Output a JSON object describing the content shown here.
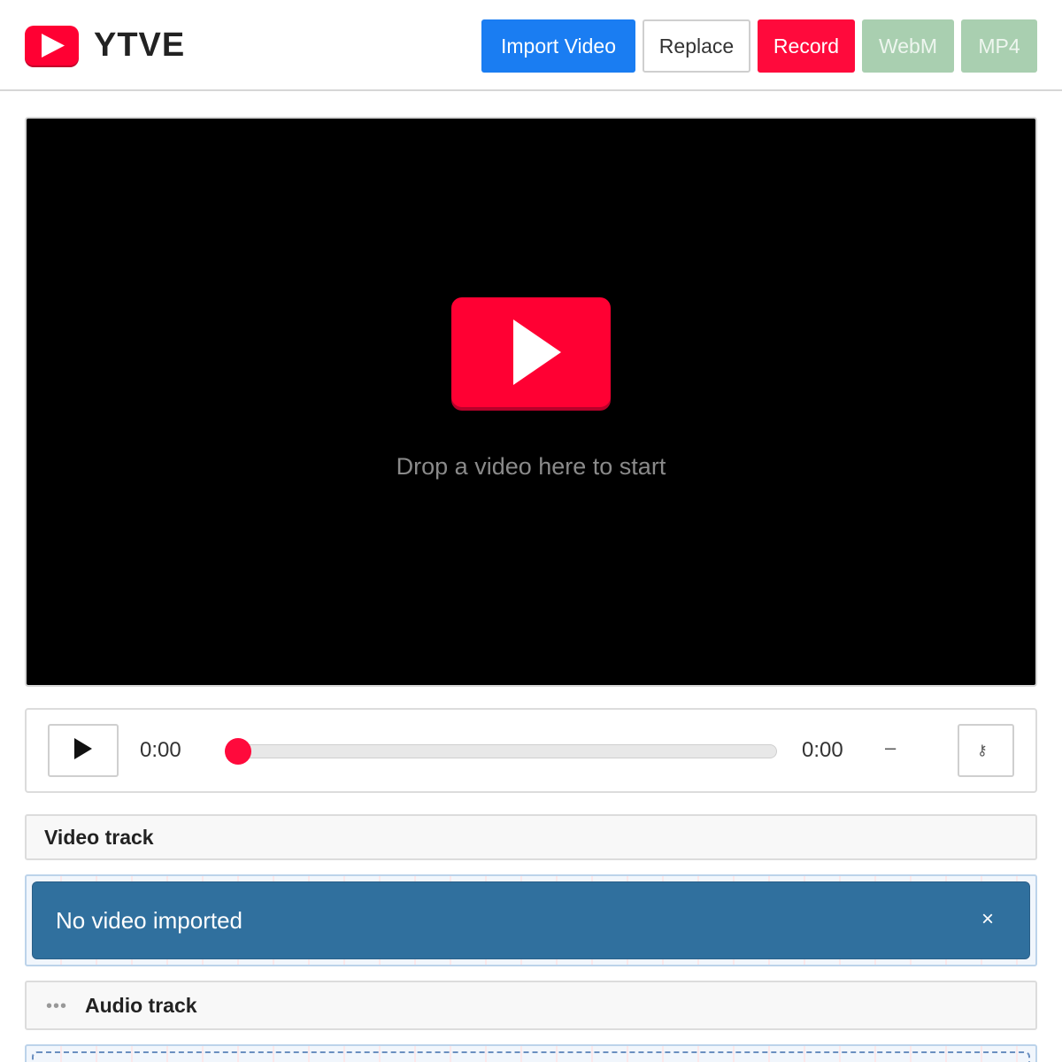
{
  "header": {
    "brand": "YTVE",
    "buttons": {
      "import": "Import Video",
      "replace": "Replace",
      "record": "Record",
      "webm": "WebM",
      "mp4": "MP4"
    }
  },
  "stage": {
    "drop_text": "Drop a video here to start"
  },
  "controls": {
    "current_time": "0:00",
    "duration": "0:00",
    "separator": "–",
    "progress_fraction": 0,
    "key_icon": "⚷"
  },
  "tracks": {
    "video": {
      "title": "Video track",
      "clip_label": "No video imported",
      "close": "×"
    },
    "audio": {
      "title": "Audio track",
      "handle": "•••"
    }
  },
  "colors": {
    "accent_red": "#ff0033",
    "primary_blue": "#1a7df2",
    "export_green": "#a9cfb0",
    "clip_blue": "#30709e"
  }
}
